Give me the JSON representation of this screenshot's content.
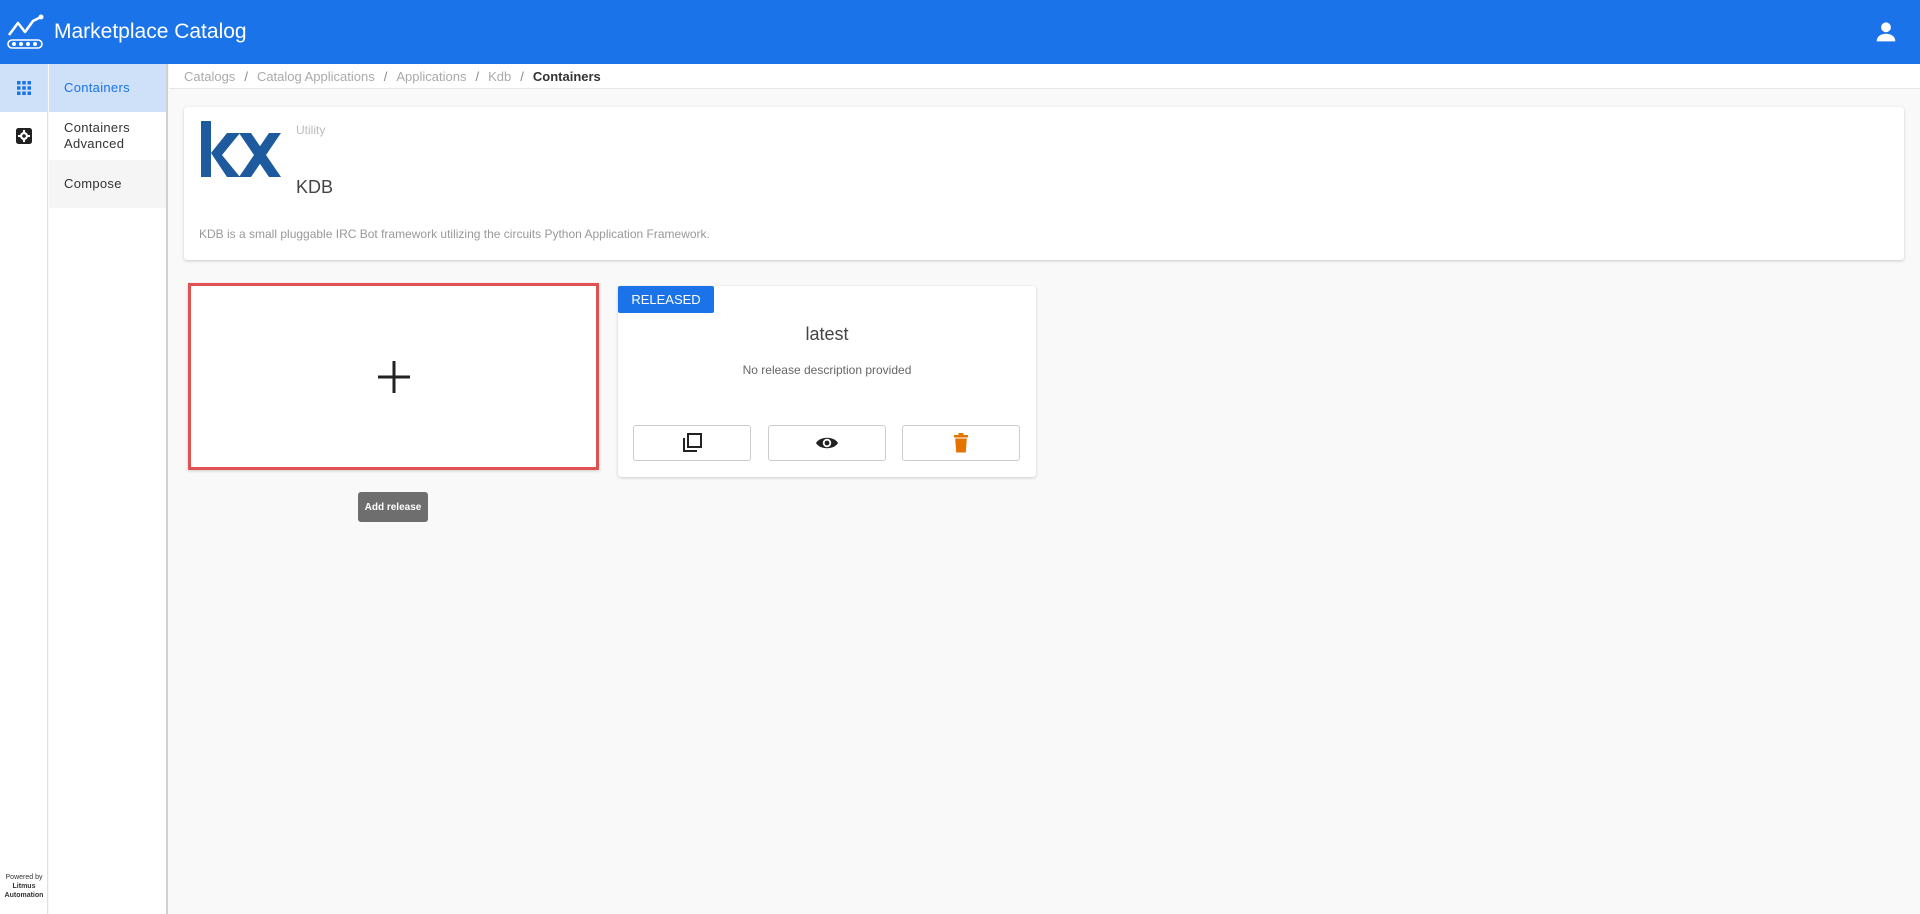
{
  "header": {
    "title": "Marketplace Catalog"
  },
  "rail": {
    "items": [
      "apps-icon",
      "settings-icon"
    ]
  },
  "powered": {
    "line1": "Powered by",
    "line2": "Litmus",
    "line3": "Automation"
  },
  "subnav": {
    "items": [
      {
        "label": "Containers"
      },
      {
        "label": "Containers Advanced"
      },
      {
        "label": "Compose"
      }
    ]
  },
  "breadcrumb": {
    "items": [
      "Catalogs",
      "Catalog Applications",
      "Applications",
      "Kdb"
    ],
    "current": "Containers"
  },
  "app": {
    "logo_text": "kx",
    "category": "Utility",
    "name": "KDB",
    "description": "KDB is a small pluggable IRC Bot framework utilizing the circuits Python Application Framework."
  },
  "add_release": {
    "tooltip": "Add release"
  },
  "release": {
    "status": "RELEASED",
    "name": "latest",
    "description": "No release description provided"
  },
  "colors": {
    "primary": "#1a73e8",
    "highlight": "#e05252",
    "delete": "#e37400",
    "kx_logo": "#1d5a9e"
  }
}
